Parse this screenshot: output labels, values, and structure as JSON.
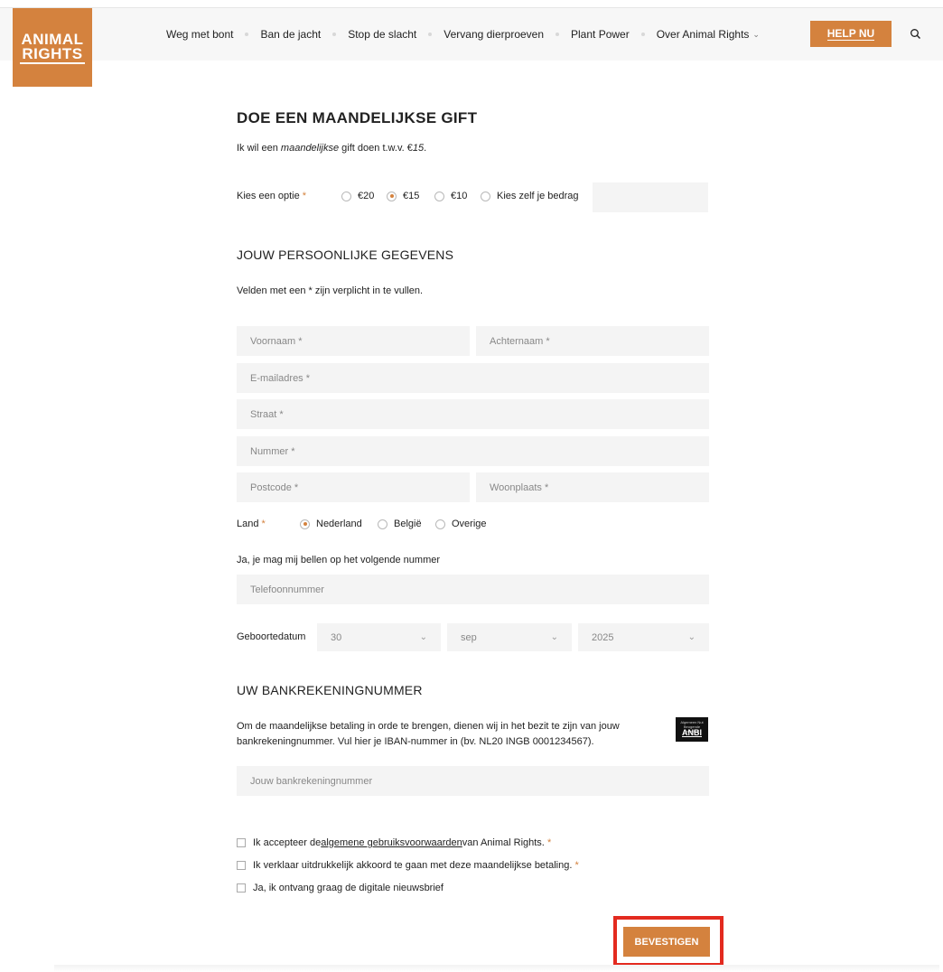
{
  "logo": {
    "line1": "ANIMAL",
    "line2": "RIGHTS"
  },
  "nav": {
    "items": [
      "Weg met bont",
      "Ban de jacht",
      "Stop de slacht",
      "Vervang dierproeven",
      "Plant Power",
      "Over Animal Rights"
    ],
    "help_label": "HELP NU"
  },
  "gift": {
    "title": "DOE EEN MAANDELIJKSE GIFT",
    "intro_prefix": "Ik wil een ",
    "intro_em": "maandelijkse",
    "intro_mid": " gift doen t.w.v. €",
    "intro_amount": "15",
    "intro_suffix": ".",
    "option_label": "Kies een optie",
    "options": [
      {
        "label": "€20",
        "selected": false
      },
      {
        "label": "€15",
        "selected": true
      },
      {
        "label": "€10",
        "selected": false
      },
      {
        "label": "Kies zelf je bedrag",
        "selected": false
      }
    ],
    "custom_amount": ""
  },
  "personal": {
    "title": "JOUW PERSOONLIJKE GEGEVENS",
    "note": "Velden met een * zijn verplicht in te vullen.",
    "placeholders": {
      "firstname": "Voornaam *",
      "lastname": "Achternaam *",
      "email": "E-mailadres *",
      "street": "Straat *",
      "number": "Nummer *",
      "postcode": "Postcode *",
      "city": "Woonplaats *",
      "phone": "Telefoonnummer"
    },
    "country_label": "Land",
    "countries": [
      {
        "label": "Nederland",
        "selected": true
      },
      {
        "label": "België",
        "selected": false
      },
      {
        "label": "Overige",
        "selected": false
      }
    ],
    "phone_label": "Ja, je mag mij bellen op het volgende nummer",
    "birth_label": "Geboortedatum",
    "birth": {
      "day": "30",
      "month": "sep",
      "year": "2025"
    }
  },
  "bank": {
    "title": "UW BANKREKENINGNUMMER",
    "text_line1": "Om de maandelijkse betaling in orde te brengen, dienen wij in het bezit te zijn van jouw",
    "text_line2": "bankrekeningnummer. Vul hier je IBAN-nummer in (bv. NL20 INGB 0001234567).",
    "anbi_small": "Algemeen Nut Beogende Instelling",
    "anbi_big": "ANBI",
    "iban_placeholder": "Jouw bankrekeningnummer"
  },
  "agreements": {
    "terms_prefix": "Ik accepteer de ",
    "terms_link": "algemene gebruiksvoorwaarden",
    "terms_suffix": " van Animal Rights.",
    "consent": "Ik verklaar uitdrukkelijk akkoord te gaan met deze maandelijkse betaling.",
    "newsletter": "Ja, ik ontvang graag de digitale nieuwsbrief"
  },
  "submit_label": "BEVESTIGEN",
  "colors": {
    "accent": "#d4823e",
    "highlight": "#e32a1f",
    "field_bg": "#f4f4f4"
  }
}
